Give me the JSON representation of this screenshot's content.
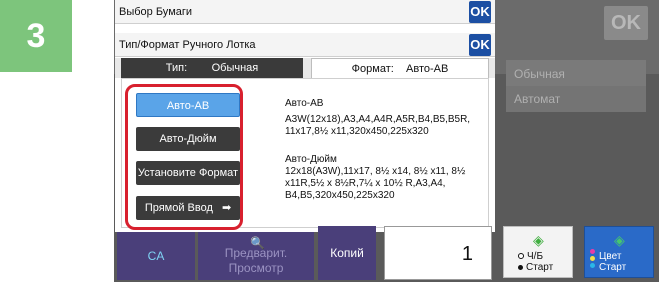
{
  "step": "3",
  "background": {
    "ok_label": "OK",
    "ghost_line1": "Обычная",
    "ghost_line2": "Автомат"
  },
  "dialog": {
    "paper_select_label": "Выбор Бумаги",
    "bypass_label": "Тип/Формат Ручного Лотка",
    "ok_label": "OK",
    "tabs": {
      "type_label": "Тип:",
      "type_value": "Обычная",
      "format_label": "Формат:",
      "format_value": "Авто-AB"
    },
    "format_buttons": [
      {
        "label": "Авто-AB",
        "selected": true
      },
      {
        "label": "Авто-Дюйм",
        "selected": false
      },
      {
        "label": "Установите Формат",
        "selected": false
      },
      {
        "label": "Прямой Ввод",
        "selected": false
      }
    ],
    "info": {
      "ab_title": "Авто-AB",
      "ab_sizes": "A3W(12x18),A3,A4,A4R,A5R,B4,B5,B5R, 11x17,8½ x11,320x450,225x320",
      "inch_title": "Авто-Дюйм",
      "inch_sizes": "12x18(A3W),11x17, 8½ x14, 8½ x11, 8½ x11R,5½ x 8½R,7¼ x 10½ R,A3,A4, B4,B5,320x450,225x320"
    }
  },
  "bottom": {
    "ca_label": "CA",
    "preview_label": "Предварит. Просмотр",
    "copies_label": "Копий",
    "copies_value": "1",
    "bw_label": "Ч/Б",
    "bw_start": "Старт",
    "color_label": "Цвет",
    "color_start": "Старт"
  },
  "colors": {
    "step_badge": "#7dc57c",
    "ok_button": "#1c4fa3",
    "selected_format": "#5aa4e8",
    "highlight_frame": "#d8202e",
    "bottom_bar": "#4a3f7a",
    "color_start": "#2a6ac8"
  }
}
